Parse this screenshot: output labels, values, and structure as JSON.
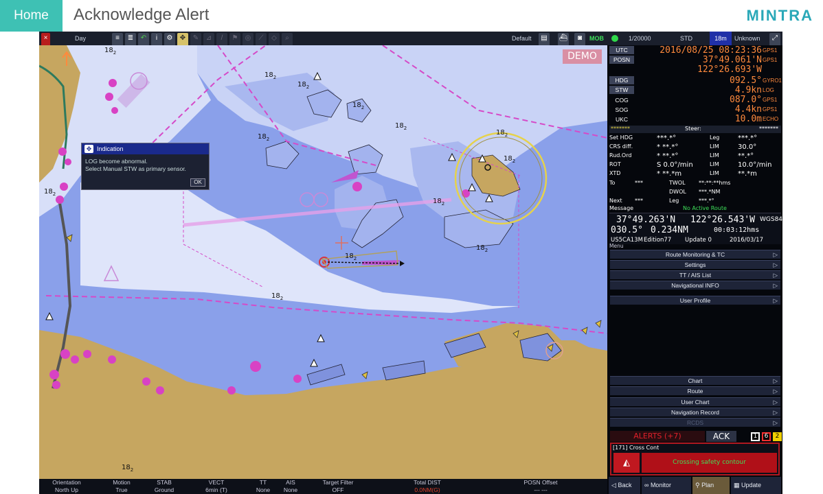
{
  "header": {
    "home": "Home",
    "title": "Acknowledge Alert",
    "brand": "MINTRA"
  },
  "toolbar": {
    "mode": "Day",
    "default_label": "Default",
    "mob": "MOB",
    "scale": "1/20000",
    "std": "STD",
    "range": "18m",
    "unknown": "Unknown"
  },
  "chart": {
    "demo": "DEMO",
    "depths": [
      {
        "t": "18",
        "s": "2"
      },
      {
        "t": "18",
        "s": "2"
      },
      {
        "t": "18",
        "s": "2"
      },
      {
        "t": "18",
        "s": "2"
      },
      {
        "t": "18",
        "s": "2"
      },
      {
        "t": "18",
        "s": "2"
      },
      {
        "t": "18",
        "s": "2"
      },
      {
        "t": "18",
        "s": "2"
      },
      {
        "t": "18",
        "s": "2"
      },
      {
        "t": "18",
        "s": "2"
      },
      {
        "t": "18",
        "s": "2"
      },
      {
        "t": "18",
        "s": "2"
      },
      {
        "t": "18",
        "s": "2"
      },
      {
        "t": "18",
        "s": "2"
      }
    ]
  },
  "dialog": {
    "title": "Indication",
    "line1": "LOG become abnormal.",
    "line2": "Select Manual STW as primary sensor.",
    "ok": "OK"
  },
  "statusbar": [
    {
      "h": "Orientation",
      "v": "North Up"
    },
    {
      "h": "Motion",
      "v": "True"
    },
    {
      "h": "STAB",
      "v": "Ground"
    },
    {
      "h": "VECT",
      "v": "6min (T)"
    },
    {
      "h": "TT",
      "v": "None"
    },
    {
      "h": "AIS",
      "v": "None"
    },
    {
      "h": "Target Filter",
      "v": "OFF"
    },
    {
      "h": "Total DIST",
      "v": "0.0NM(G)"
    },
    {
      "h": "POSN Offset",
      "v": "--- ---"
    }
  ],
  "panel": {
    "utc_label": "UTC",
    "utc": "2016/08/25 08:23:36",
    "utc_src": "GPS1",
    "posn_label": "POSN",
    "lat": "37°49.061'N",
    "lat_src": "GPS1",
    "lon": "122°26.693'W",
    "hdg_label": "HDG",
    "hdg": "092.5°",
    "hdg_src": "GYRO1",
    "stw_label": "STW",
    "stw": "4.9kn",
    "stw_src": "LOG",
    "cog_label": "COG",
    "cog": "087.0°",
    "cog_src": "GPS1",
    "sog_label": "SOG",
    "sog": "4.4kn",
    "sog_src": "GPS1",
    "ukc_label": "UKC",
    "ukc": "10.0m",
    "ukc_src": "ECHO",
    "steer_stars_l": "*******",
    "steer": "Steer:",
    "steer_stars_r": "*******",
    "nav": [
      {
        "a": "Set HDG",
        "b": "***.*°",
        "c": "Leg",
        "d": "***.*°"
      },
      {
        "a": "CRS diff.",
        "b": "*  **.*°",
        "c": "LIM",
        "d": "30.0°"
      },
      {
        "a": "Rud.Ord",
        "b": "*  **.*°",
        "c": "LIM",
        "d": "**.*°"
      },
      {
        "a": "ROT",
        "b": "S  0.0°/min",
        "c": "LIM",
        "d": "10.0°/min"
      },
      {
        "a": "XTD",
        "b": "*  **.*m",
        "c": "LIM",
        "d": "**.*m"
      }
    ],
    "to_label": "To",
    "to_val": "***",
    "twol": "TWOL",
    "twol_val": "**:**:**hms",
    "dwol": "DWOL",
    "dwol_val": "***.*NM",
    "next_label": "Next",
    "next_val": "***",
    "leg2": "Leg",
    "leg2_val": "***.*°",
    "msg_label": "Message",
    "msg_val": "No Active Route",
    "cur_lat": "37°49.263'N",
    "cur_lon": "122°26.543'W",
    "datum": "WGS84",
    "brg": "030.5°",
    "dist": "0.234NM",
    "ttg": "00:03:12hms",
    "cell": "US5CA13M",
    "edition": "Edition77",
    "update": "Update 0",
    "date": "2016/03/17",
    "menu_title": "Menu",
    "menu1": [
      "Route Monitoring & TC",
      "Settings",
      "TT / AIS List",
      "Navigational INFO"
    ],
    "user_profile": "User Profile",
    "menu2": [
      "Chart",
      "Route",
      "User Chart",
      "Navigation Record",
      "RCDS"
    ],
    "alerts": "ALERTS (+7)",
    "ack": "ACK",
    "counts": [
      {
        "v": "1",
        "c": "#ffffff"
      },
      {
        "v": "6",
        "c": "#ff3030"
      },
      {
        "v": "2",
        "c": "#f0d000"
      }
    ],
    "alert_head": "[171] Cross Cont",
    "alert_msg": "Crossing safety contour",
    "bottom": [
      "Back",
      "Monitor",
      "Plan",
      "Update"
    ]
  },
  "colors": {
    "accent": "#3ec1b4",
    "brand": "#2aa8b8",
    "land": "#c6a660",
    "deep": "#7f92dd",
    "shallow": "#9cb0ef",
    "alert": "#e0202a"
  }
}
